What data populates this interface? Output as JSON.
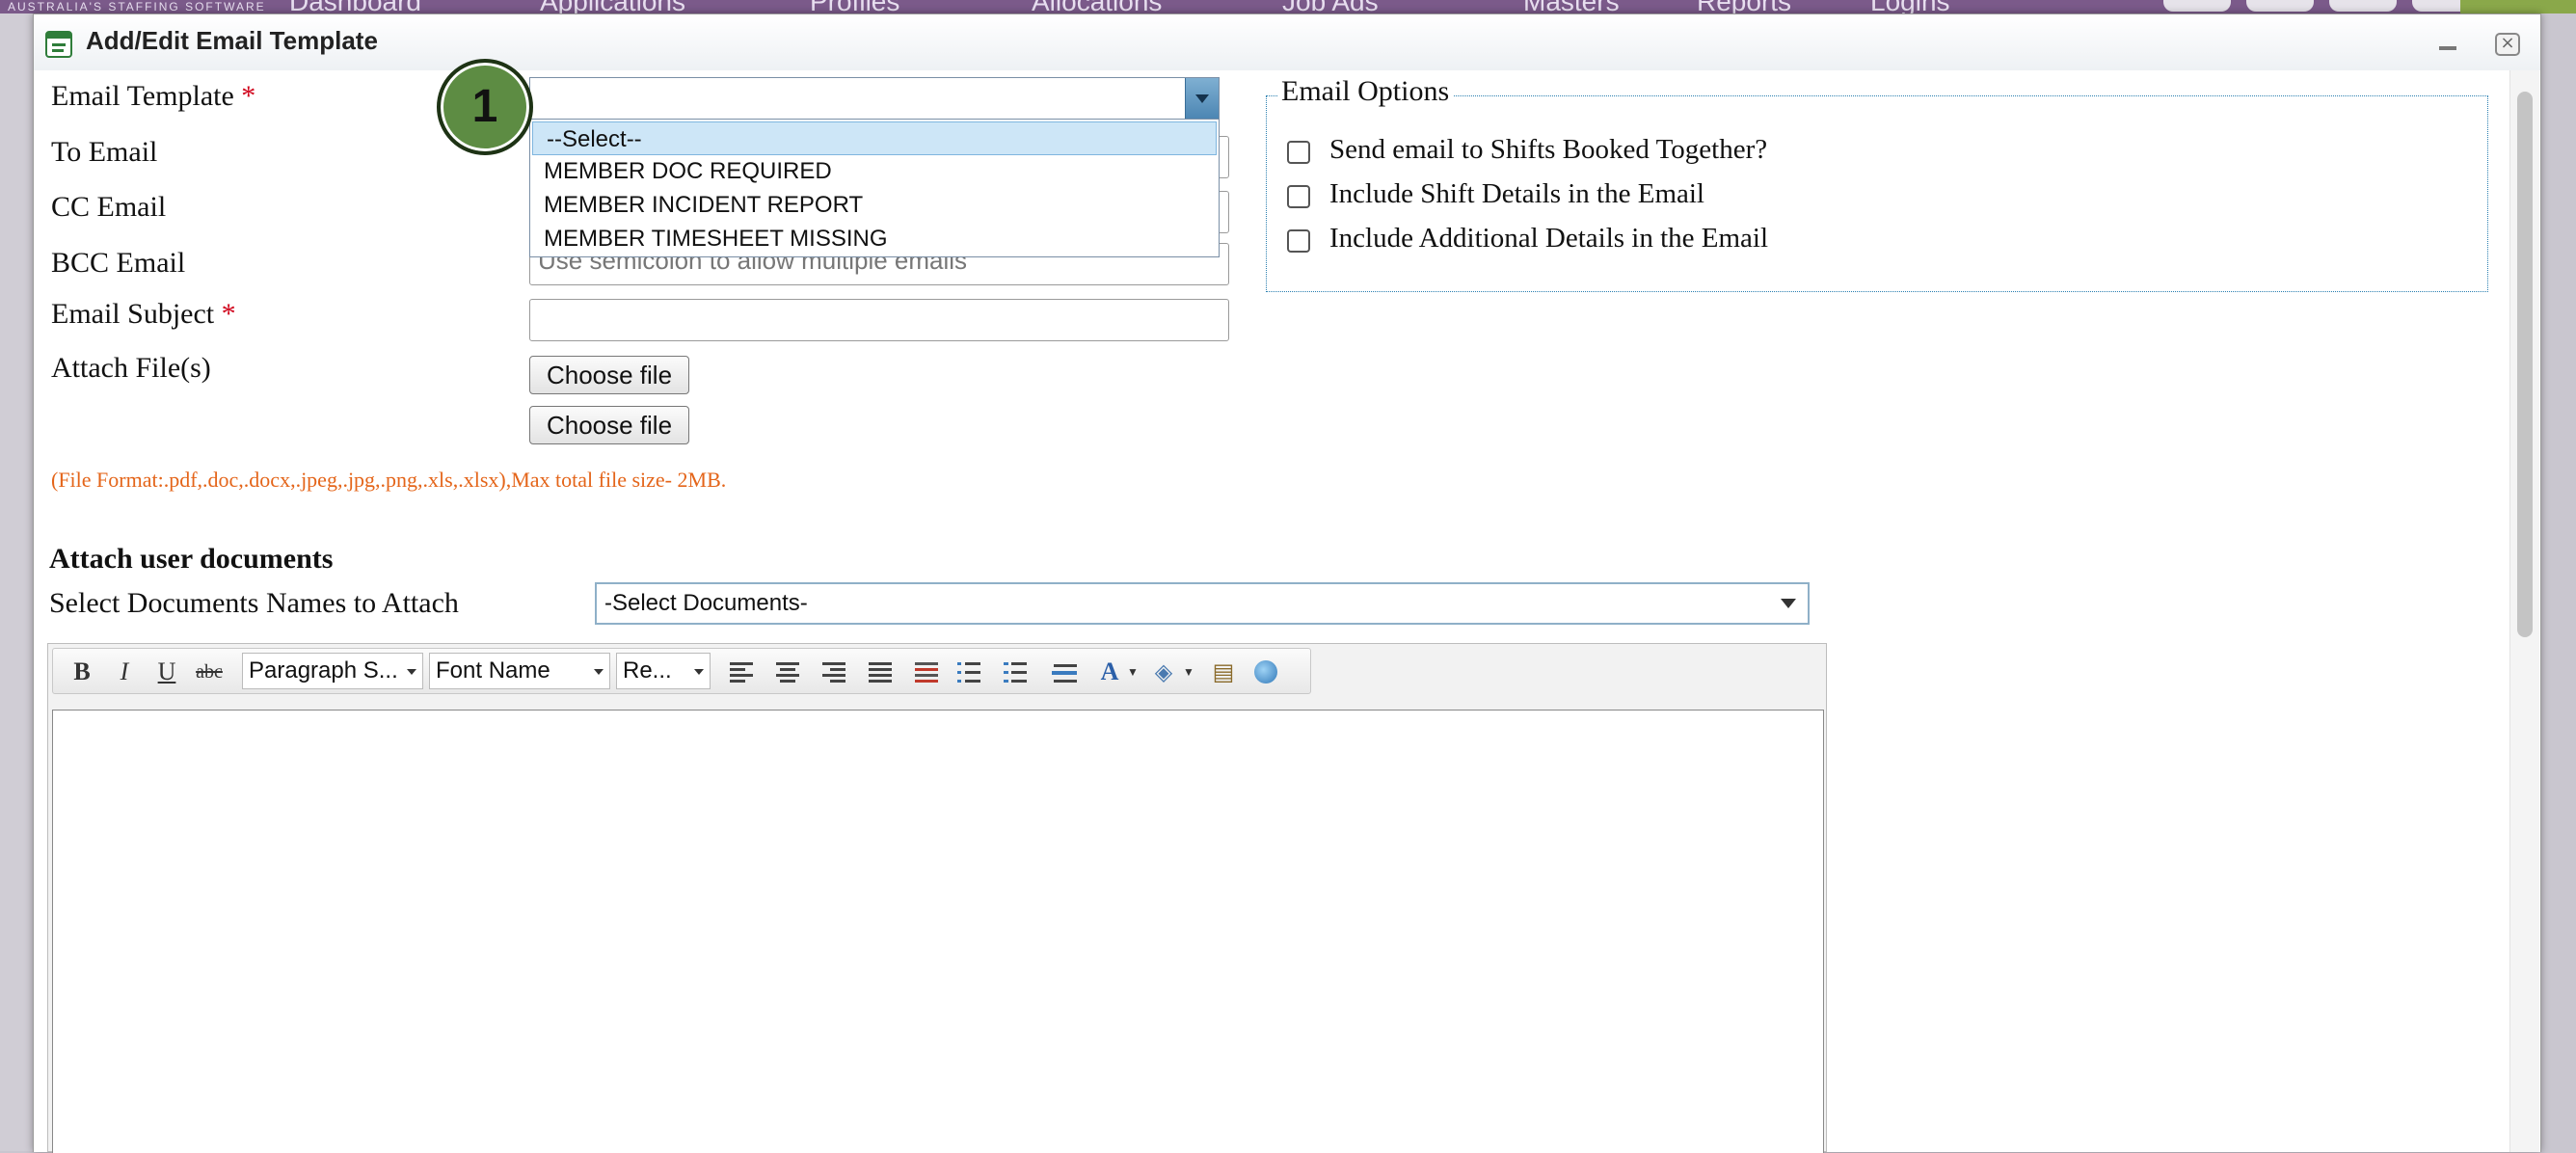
{
  "background_app": {
    "brand": "AUSTRALIA'S STAFFING SOFTWARE",
    "nav": [
      "Dashboard",
      "Applications",
      "Profiles",
      "Allocations",
      "Job Ads",
      "Masters",
      "Reports",
      "Logins"
    ]
  },
  "dialog": {
    "title": "Add/Edit Email Template",
    "icons": {
      "title": "template-icon",
      "minimize": "minimize-icon",
      "close": "close-icon"
    }
  },
  "form": {
    "email_template": {
      "label": "Email Template",
      "required_mark": "*",
      "value": "",
      "options": [
        "--Select--",
        "MEMBER DOC REQUIRED",
        "MEMBER INCIDENT REPORT",
        "MEMBER TIMESHEET MISSING"
      ],
      "highlighted_option": "--Select--"
    },
    "to_email": {
      "label": "To Email"
    },
    "cc_email": {
      "label": "CC Email"
    },
    "bcc_email": {
      "label": "BCC Email",
      "placeholder": "Use semicolon to allow multiple emails"
    },
    "email_subject": {
      "label": "Email Subject",
      "required_mark": "*",
      "value": ""
    },
    "attach_files": {
      "label": "Attach File(s)",
      "buttons": [
        "Choose file",
        "Choose file"
      ],
      "note": "(File Format:.pdf,.doc,.docx,.jpeg,.jpg,.png,.xls,.xlsx),Max total file size- 2MB."
    }
  },
  "email_options": {
    "legend": "Email Options",
    "items": [
      {
        "label": "Send email to Shifts Booked Together?",
        "checked": false
      },
      {
        "label": "Include Shift Details in the Email",
        "checked": false
      },
      {
        "label": "Include Additional Details in the Email",
        "checked": false
      }
    ]
  },
  "user_documents": {
    "heading": "Attach user documents",
    "select_label": "Select Documents Names to Attach",
    "select_value": "-Select Documents-"
  },
  "editor": {
    "paragraph_style": "Paragraph S...",
    "font_name": "Font Name",
    "font_size": "Re...",
    "bold": "B",
    "italic": "I",
    "underline": "U",
    "strike": "abc",
    "font_color": "A",
    "tool_icons": [
      "bold-icon",
      "italic-icon",
      "underline-icon",
      "strikethrough-icon",
      "align-left-icon",
      "align-center-icon",
      "align-right-icon",
      "align-justify-icon",
      "remove-format-icon",
      "bullet-list-icon",
      "numbered-list-icon",
      "horizontal-rule-icon",
      "font-color-icon",
      "highlight-color-icon",
      "paste-icon",
      "insert-link-icon"
    ],
    "content": ""
  },
  "step_marker": "1",
  "colors": {
    "required": "#d0021b",
    "note": "#e4651a",
    "marker": "#5d8c43"
  }
}
